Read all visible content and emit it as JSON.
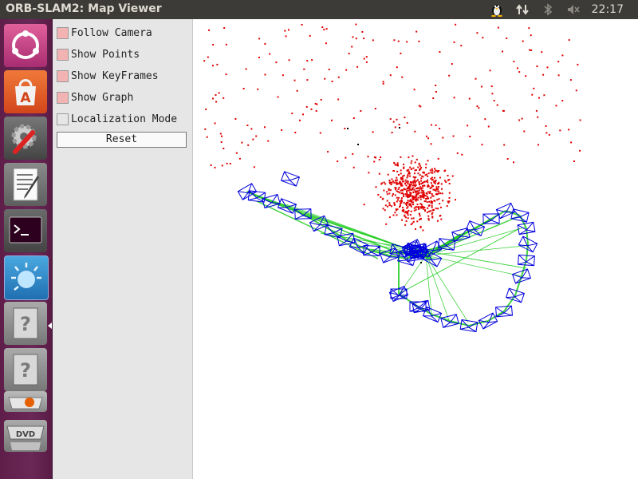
{
  "window": {
    "title": "ORB-SLAM2: Map Viewer"
  },
  "tray": {
    "time": "22:17",
    "icons": [
      "tux-icon",
      "network-arrows-icon",
      "bluetooth-icon",
      "volume-muted-icon"
    ]
  },
  "launcher": {
    "items": [
      {
        "name": "ubuntu-dash-icon",
        "color": "#dd4814",
        "running": false
      },
      {
        "name": "software-center-icon",
        "color": "#e05a1c",
        "running": false
      },
      {
        "name": "system-settings-icon",
        "color": "#555555",
        "running": false
      },
      {
        "name": "text-editor-icon",
        "color": "#7a7a7a",
        "running": true
      },
      {
        "name": "terminal-icon",
        "color": "#2b2b2b",
        "running": true
      },
      {
        "name": "splash-app-icon",
        "color": "#3aa0d8",
        "running": true
      },
      {
        "name": "unknown-app-icon",
        "color": "#9a9a9a",
        "running": true,
        "label": "?"
      },
      {
        "name": "unknown-app-icon",
        "color": "#9a9a9a",
        "running": false,
        "label": "?"
      },
      {
        "name": "stacked-apps-icon",
        "color": "#8a8a8a",
        "running": false
      },
      {
        "name": "dvd-icon",
        "color": "#8a8a8a",
        "running": true,
        "label": "DVD"
      }
    ]
  },
  "panel": {
    "checkboxes": [
      {
        "label": "Follow Camera",
        "checked": true
      },
      {
        "label": "Show Points",
        "checked": true
      },
      {
        "label": "Show KeyFrames",
        "checked": true
      },
      {
        "label": "Show Graph",
        "checked": true
      },
      {
        "label": "Localization Mode",
        "checked": false
      }
    ],
    "reset_label": "Reset"
  },
  "colors": {
    "map_points": "#e00000",
    "reference_points": "#000000",
    "keyframes": "#0000dd",
    "graph": "#22cc22",
    "checkbox_on": "#f3b3b3"
  }
}
